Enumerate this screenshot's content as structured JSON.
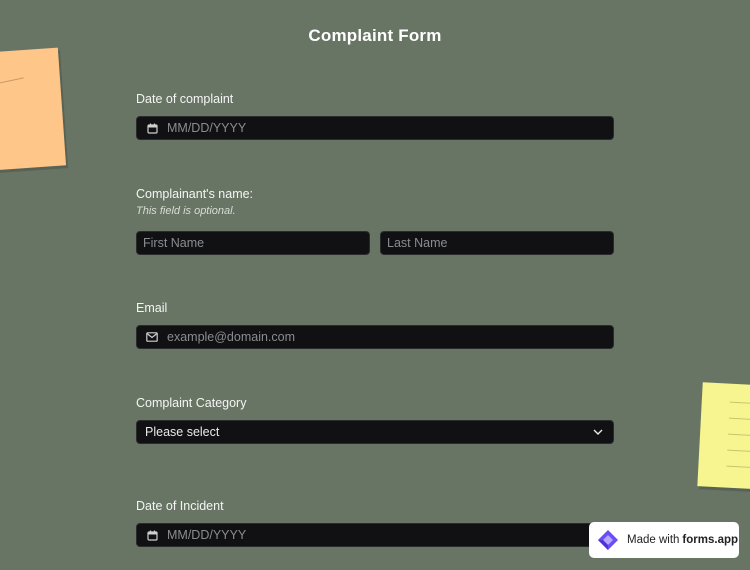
{
  "form": {
    "title": "Complaint Form",
    "date_of_complaint": {
      "label": "Date of complaint",
      "placeholder": "MM/DD/YYYY"
    },
    "complainant_name": {
      "label": "Complainant's name:",
      "hint": "This field is optional.",
      "first_placeholder": "First Name",
      "last_placeholder": "Last Name"
    },
    "email": {
      "label": "Email",
      "placeholder": "example@domain.com"
    },
    "complaint_category": {
      "label": "Complaint Category",
      "selected": "Please select"
    },
    "date_of_incident": {
      "label": "Date of Incident",
      "placeholder": "MM/DD/YYYY"
    }
  },
  "badge": {
    "prefix": "Made with",
    "brand": "forms.app"
  },
  "icons": [
    "calendar-icon",
    "mail-icon",
    "chevron-down-icon",
    "forms-app-logo-icon"
  ],
  "colors": {
    "background": "#687564",
    "field": "#111114",
    "note_orange": "#ffc68a",
    "note_yellow": "#f6f58f",
    "logo_purple": "#6b4cf6"
  }
}
